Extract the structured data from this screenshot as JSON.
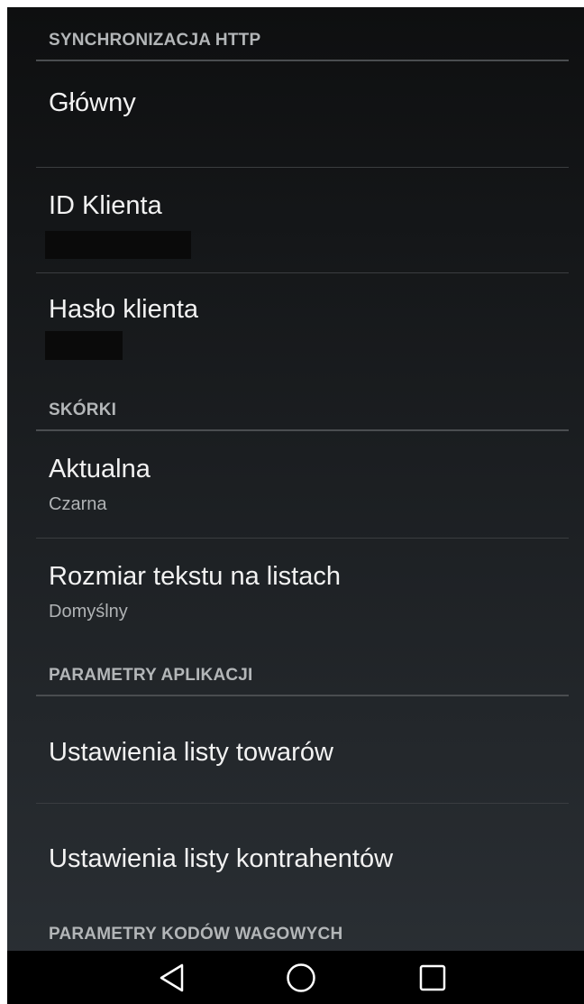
{
  "sections": {
    "http_sync": {
      "header": "SYNCHRONIZACJA HTTP",
      "items": [
        {
          "title": "Główny",
          "summary": ""
        },
        {
          "title": "ID Klienta",
          "summary": ""
        },
        {
          "title": "Hasło klienta",
          "summary": ""
        }
      ]
    },
    "skins": {
      "header": "SKÓRKI",
      "items": [
        {
          "title": "Aktualna",
          "summary": "Czarna"
        },
        {
          "title": "Rozmiar tekstu na listach",
          "summary": "Domyślny"
        }
      ]
    },
    "app_params": {
      "header": "PARAMETRY APLIKACJI",
      "items": [
        {
          "title": "Ustawienia listy towarów"
        },
        {
          "title": "Ustawienia listy kontrahentów"
        }
      ]
    },
    "weight_codes": {
      "header": "PARAMETRY KODÓW WAGOWYCH"
    }
  },
  "navbar": {
    "back_icon": "back-triangle-icon",
    "home_icon": "home-circle-icon",
    "recents_icon": "recents-square-icon"
  },
  "colors": {
    "background_top": "#0e0f10",
    "background_bottom": "#2b3035",
    "header_text": "#b3b6b8",
    "title_text": "#f2f2f2",
    "summary_text": "#b0b3b5",
    "divider": "#4a4d50"
  }
}
